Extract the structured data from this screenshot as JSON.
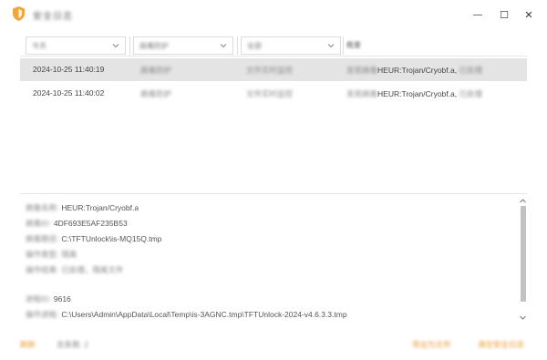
{
  "window": {
    "title": "安全日志",
    "minimize_glyph": "—",
    "maximize_glyph": "☐",
    "close_glyph": "✕"
  },
  "filters": {
    "time_range": "今天",
    "category": "病毒防护",
    "result": "全部",
    "detail_column": "概要"
  },
  "log_rows": [
    {
      "time": "2024-10-25 11:40:19",
      "category": "病毒防护",
      "source": "文件实时监控",
      "summary_prefix": "发现病毒",
      "summary_virus": "HEUR:Trojan/Cryobf.a,",
      "summary_suffix": "已处理",
      "selected": true
    },
    {
      "time": "2024-10-25 11:40:02",
      "category": "病毒防护",
      "source": "文件实时监控",
      "summary_prefix": "发现病毒",
      "summary_virus": "HEUR:Trojan/Cryobf.a,",
      "summary_suffix": "已处理",
      "selected": false
    }
  ],
  "details": {
    "virus_name_label": "病毒名称:",
    "virus_name": "HEUR:Trojan/Cryobf.a",
    "hash_label": "病毒ID:",
    "hash": "4DF693E5AF235B53",
    "path_label": "病毒路径:",
    "path": "C:\\TFTUnlock\\is-MQ15Q.tmp",
    "op_label": "操作类型:",
    "op_value": "隔离",
    "result_label": "操作结果:",
    "result_value": "已处理，隔离文件",
    "pid_label": "进程ID:",
    "pid": "9616",
    "process_label": "操作进程:",
    "process_path": "C:\\Users\\Admin\\AppData\\Local\\Temp\\is-3AGNC.tmp\\TFTUnlock-2024-v4.6.3.3.tmp"
  },
  "footer": {
    "refresh": "刷新",
    "records_label": "总条数:",
    "records_count": "2",
    "export_button": "导出为文件",
    "clear_button": "清空安全日志"
  },
  "colors": {
    "accent": "#e8952a",
    "selected_row": "#e4e4e4",
    "scroll_thumb": "#c2c2c2"
  },
  "icons": {
    "app": "shield-icon",
    "dropdown": "chevron-down-icon",
    "scroll_up": "chevron-up-icon",
    "scroll_down": "chevron-down-icon"
  }
}
